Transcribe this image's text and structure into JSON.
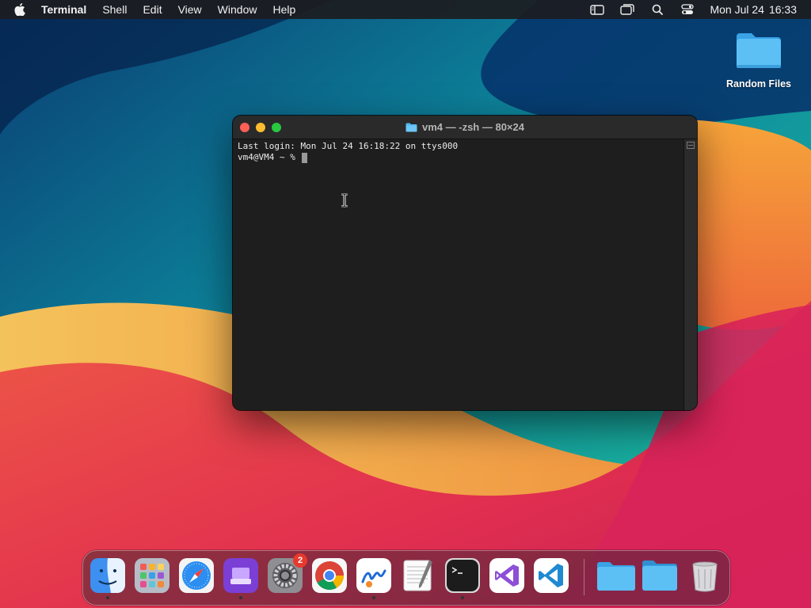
{
  "menubar": {
    "app_name": "Terminal",
    "items": [
      "Shell",
      "Edit",
      "View",
      "Window",
      "Help"
    ],
    "clock_date": "Mon Jul 24",
    "clock_time": "16:33"
  },
  "desktop": {
    "icons": [
      {
        "label": "Random Files",
        "icon": "folder-icon"
      }
    ]
  },
  "terminal": {
    "title": "vm4 — -zsh — 80×24",
    "lines": [
      "Last login: Mon Jul 24 16:18:22 on ttys000",
      "vm4@VM4 ~ % "
    ]
  },
  "dock": {
    "items": [
      {
        "name": "finder",
        "icon": "finder-icon",
        "running": true
      },
      {
        "name": "launchpad",
        "icon": "launchpad-icon",
        "running": false
      },
      {
        "name": "safari",
        "icon": "safari-icon",
        "running": false
      },
      {
        "name": "podcasts-dock",
        "icon": "purple-app-icon",
        "running": true
      },
      {
        "name": "system-settings",
        "icon": "gear-icon",
        "running": false,
        "badge": "2"
      },
      {
        "name": "chrome",
        "icon": "chrome-icon",
        "running": false
      },
      {
        "name": "freeform",
        "icon": "freeform-icon",
        "running": true
      },
      {
        "name": "textedit",
        "icon": "textedit-icon",
        "running": false
      },
      {
        "name": "terminal",
        "icon": "terminal-icon",
        "running": true
      },
      {
        "name": "visual-studio",
        "icon": "visual-studio-icon",
        "running": false
      },
      {
        "name": "vscode",
        "icon": "vscode-icon",
        "running": false
      },
      {
        "name": "folder-1",
        "icon": "folder-icon",
        "running": false
      },
      {
        "name": "folder-2",
        "icon": "folder-icon",
        "running": false
      },
      {
        "name": "trash",
        "icon": "trash-icon",
        "running": false
      }
    ]
  },
  "colors": {
    "terminal_bg": "#1e1e1e",
    "folder_blue": "#4fb6f2",
    "badge_red": "#e8392e"
  }
}
